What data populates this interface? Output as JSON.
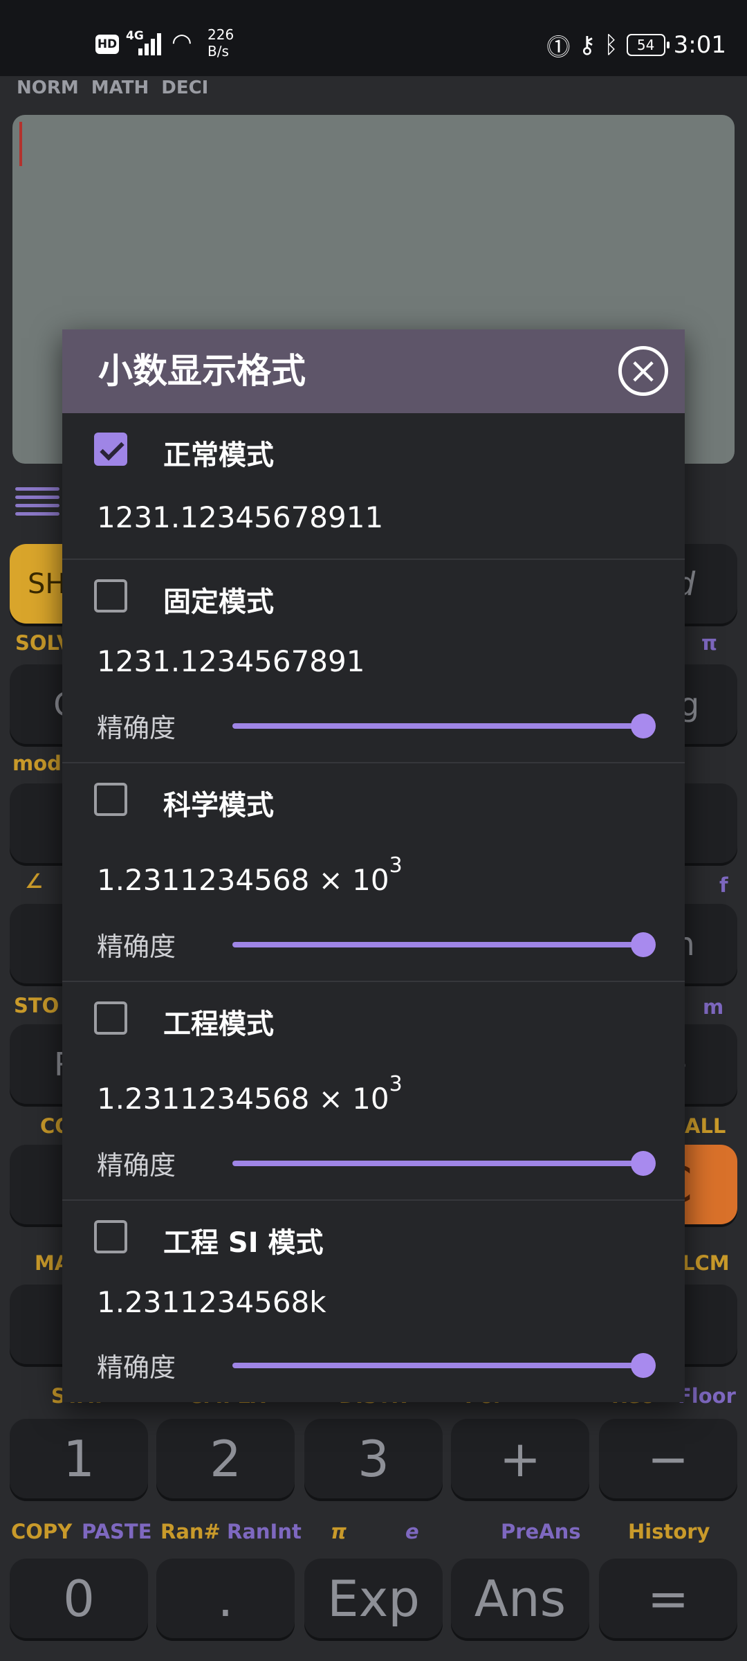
{
  "status_bar": {
    "hd": "HD",
    "network": "4G",
    "speed_value": "226",
    "speed_unit": "B/s",
    "battery": "54",
    "time": "3:01"
  },
  "modes": [
    "NORM",
    "MATH",
    "DECI"
  ],
  "keypad": {
    "shift_label": "SH",
    "row2_labels": {
      "left": "SOLV",
      "right": "π"
    },
    "ca_label": "CA",
    "log_label": "log",
    "mod_label": "mod",
    "angle_label": "∠",
    "f_label": "f",
    "sto_label": "STO",
    "m_label": "m",
    "rc_label": "RC",
    "co_label": "CO",
    "all_label": "ALL",
    "ma_label": "MA",
    "lcm_label": "LCM",
    "stat_row": [
      "STAT",
      "CMPLX",
      "DISTR",
      "Pol",
      "Rec",
      "Floor"
    ],
    "digit_row": [
      "1",
      "2",
      "3",
      "+",
      "−"
    ],
    "bottom_labels": [
      "COPY",
      "PASTE",
      "Ran#",
      "RanInt",
      "π",
      "e",
      "PreAns",
      "History"
    ],
    "bottom_row": [
      "0",
      ".",
      "Exp",
      "Ans",
      "="
    ]
  },
  "dialog": {
    "title": "小数显示格式",
    "options": [
      {
        "name": "正常模式",
        "checked": true,
        "value": "1231.12345678911"
      },
      {
        "name": "固定模式",
        "checked": false,
        "value": "1231.1234567891",
        "precision_label": "精确度",
        "precision": 1.0
      },
      {
        "name": "科学模式",
        "checked": false,
        "value": "1.2311234568 × 10",
        "exponent": "3",
        "precision_label": "精确度",
        "precision": 1.0
      },
      {
        "name": "工程模式",
        "checked": false,
        "value": "1.2311234568 × 10",
        "exponent": "3",
        "precision_label": "精确度",
        "precision": 1.0
      },
      {
        "name": "工程 SI 模式",
        "checked": false,
        "value": "1.2311234568k",
        "precision_label": "精确度",
        "precision": 1.0
      }
    ]
  }
}
